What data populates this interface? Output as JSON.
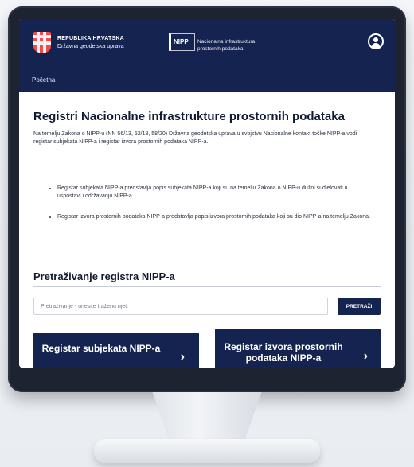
{
  "header": {
    "brand_line1": "REPUBLIKA HRVATSKA",
    "brand_line2": "Državna geodetska uprava",
    "nipp_logo": "NIPP",
    "nipp_desc_line1": "Nacionalna infrastruktura",
    "nipp_desc_line2": "prostornih podataka",
    "user_icon": "user-icon"
  },
  "breadcrumb": {
    "home": "Početna"
  },
  "main": {
    "title": "Registri Nacionalne infrastrukture prostornih podataka",
    "intro": "Na temelju Zakona o NIPP-u (NN 56/13, 52/18, 58/20) Državna geodetska uprava u svojstvu Nacionalne kontakt točke NIPP-a vodi registar subjekata NIPP-a i registar izvora prostornih podataka NIPP-a.",
    "bullets": [
      "Registar subjekata NIPP-a predstavlja popis subjekata NIPP-a koji su na temelju Zakona o NIPP-u dužni sudjelovati u uspostavi i održavanju NIPP-a.",
      "Registar izvora prostornih podataka NIPP-a predstavlja popis izvora prostornih podataka koji su dio NIPP-a na temelju Zakona."
    ],
    "search_title": "Pretraživanje registra NIPP-a",
    "search_placeholder": "Pretraživanje - unesite traženu riječ",
    "search_button": "PRETRAŽI",
    "cta_left": "Registar subjekata NIPP-a",
    "cta_right": "Registar izvora prostornih podataka NIPP-a",
    "chevron": "›"
  }
}
